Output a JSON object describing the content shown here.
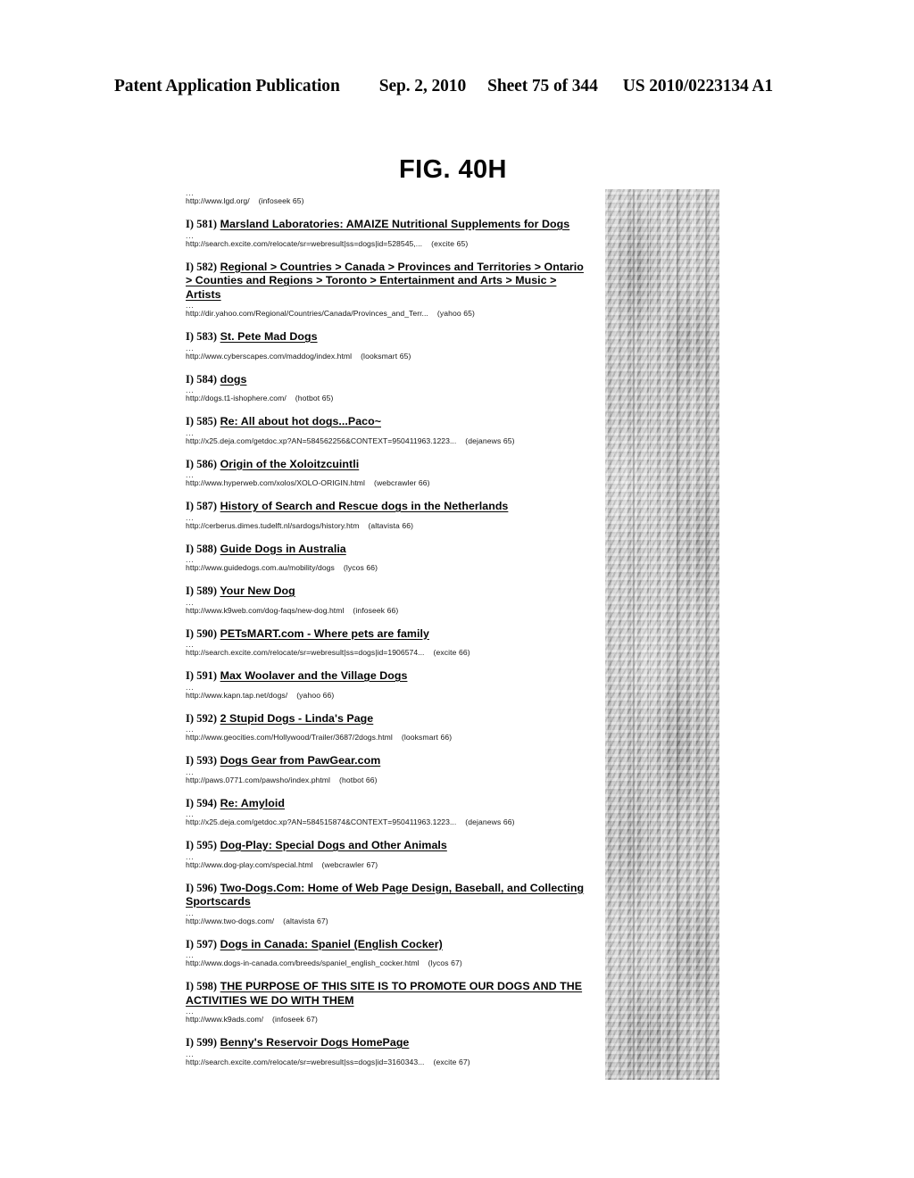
{
  "header": {
    "publication": "Patent Application Publication",
    "date": "Sep. 2, 2010",
    "sheet": "Sheet 75 of 344",
    "number": "US 2010/0223134 A1"
  },
  "figure": {
    "title": "FIG. 40H"
  },
  "artifact": {
    "name": "scan-smudge-band",
    "color": "#b9b9b9"
  },
  "orphan_url": {
    "ellipsis": "...",
    "url": "http://www.lgd.org/",
    "engine": "(infoseek  65)"
  },
  "results": [
    {
      "index": "I) 581)",
      "title": "Marsland Laboratories: AMAIZE Nutritional Supplements for Dogs",
      "ellipsis": "...",
      "url": "http://search.excite.com/relocate/sr=webresult|ss=dogs|id=528545,...",
      "engine": "(excite  65)"
    },
    {
      "index": "I) 582)",
      "title": "Regional > Countries > Canada > Provinces and Territories > Ontario > Counties and Regions > Toronto > Entertainment and Arts > Music > Artists",
      "ellipsis": "...",
      "url": "http://dir.yahoo.com/Regional/Countries/Canada/Provinces_and_Terr...",
      "engine": "(yahoo  65)"
    },
    {
      "index": "I) 583)",
      "title": "St. Pete Mad Dogs",
      "ellipsis": "...",
      "url": "http://www.cyberscapes.com/maddog/index.html",
      "engine": "(looksmart  65)"
    },
    {
      "index": "I) 584)",
      "title": "dogs",
      "ellipsis": "...",
      "url": "http://dogs.t1-ishophere.com/",
      "engine": "(hotbot  65)"
    },
    {
      "index": "I) 585)",
      "title": "Re: All about hot dogs...Paco~",
      "ellipsis": "...",
      "url": "http://x25.deja.com/getdoc.xp?AN=584562256&CONTEXT=950411963.1223...",
      "engine": "(dejanews  65)"
    },
    {
      "index": "I) 586)",
      "title": "Origin of the Xoloitzcuintli",
      "ellipsis": "...",
      "url": "http://www.hyperweb.com/xolos/XOLO-ORIGIN.html",
      "engine": "(webcrawler  66)"
    },
    {
      "index": "I) 587)",
      "title": "History of Search and Rescue dogs in the Netherlands",
      "ellipsis": "...",
      "url": "http://cerberus.dimes.tudelft.nl/sardogs/history.htm",
      "engine": "(altavista  66)"
    },
    {
      "index": "I) 588)",
      "title": "Guide Dogs in Australia",
      "ellipsis": "...",
      "url": "http://www.guidedogs.com.au/mobility/dogs",
      "engine": "(lycos  66)"
    },
    {
      "index": "I) 589)",
      "title": "Your New Dog",
      "ellipsis": "...",
      "url": "http://www.k9web.com/dog-faqs/new-dog.html",
      "engine": "(infoseek  66)"
    },
    {
      "index": "I) 590)",
      "title": "PETsMART.com - Where pets are family",
      "ellipsis": "...",
      "url": "http://search.excite.com/relocate/sr=webresult|ss=dogs|id=1906574...",
      "engine": "(excite  66)"
    },
    {
      "index": "I) 591)",
      "title": "Max Woolaver and the Village Dogs",
      "ellipsis": "...",
      "url": "http://www.kapn.tap.net/dogs/",
      "engine": "(yahoo  66)"
    },
    {
      "index": "I) 592)",
      "title": "2 Stupid Dogs - Linda's Page",
      "ellipsis": "...",
      "url": "http://www.geocities.com/Hollywood/Trailer/3687/2dogs.html",
      "engine": "(looksmart  66)"
    },
    {
      "index": "I) 593)",
      "title": "Dogs Gear from PawGear.com",
      "ellipsis": "...",
      "url": "http://paws.0771.com/pawsho/index.phtml",
      "engine": "(hotbot  66)"
    },
    {
      "index": "I) 594)",
      "title": "Re: Amyloid",
      "ellipsis": "...",
      "url": "http://x25.deja.com/getdoc.xp?AN=584515874&CONTEXT=950411963.1223...",
      "engine": "(dejanews  66)"
    },
    {
      "index": "I) 595)",
      "title": "Dog-Play: Special Dogs and Other Animals",
      "ellipsis": "...",
      "url": "http://www.dog-play.com/special.html",
      "engine": "(webcrawler  67)"
    },
    {
      "index": "I) 596)",
      "title": "Two-Dogs.Com: Home of Web Page Design, Baseball, and Collecting Sportscards",
      "ellipsis": "...",
      "url": "http://www.two-dogs.com/",
      "engine": "(altavista  67)"
    },
    {
      "index": "I) 597)",
      "title": "Dogs in Canada: Spaniel (English Cocker)",
      "ellipsis": "...",
      "url": "http://www.dogs-in-canada.com/breeds/spaniel_english_cocker.html",
      "engine": "(lycos  67)"
    },
    {
      "index": "I) 598)",
      "title": "THE PURPOSE OF THIS SITE IS TO PROMOTE OUR DOGS AND THE ACTIVITIES WE DO WITH THEM",
      "ellipsis": "...",
      "url": "http://www.k9ads.com/",
      "engine": "(infoseek  67)"
    },
    {
      "index": "I) 599)",
      "title": "Benny's Reservoir Dogs HomePage",
      "ellipsis": "...",
      "url": "http://search.excite.com/relocate/sr=webresult|ss=dogs|id=3160343...",
      "engine": "(excite  67)"
    }
  ]
}
